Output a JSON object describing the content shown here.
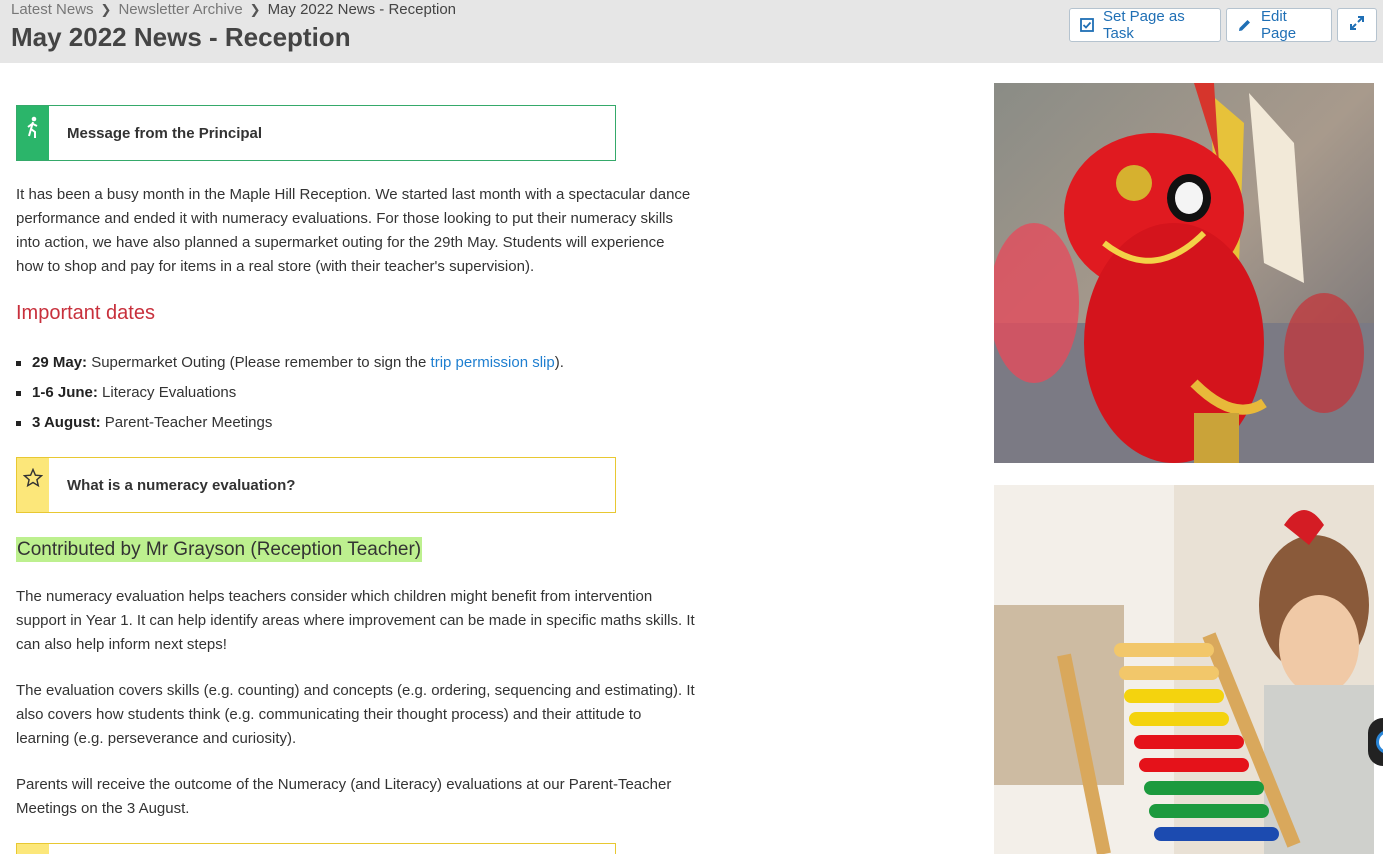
{
  "breadcrumb": {
    "items": [
      "Latest News",
      "Newsletter Archive"
    ],
    "current": "May 2022 News - Reception"
  },
  "page": {
    "title": "May 2022 News - Reception"
  },
  "actions": {
    "set_task": "Set Page as Task",
    "edit": "Edit Page",
    "expand_icon": "expand-icon"
  },
  "callouts": {
    "principal": {
      "title": "Message from the Principal",
      "icon": "walking-person-icon",
      "color": "#2bb56a"
    },
    "numeracy": {
      "title": "What is a numeracy evaluation?",
      "icon": "star-icon",
      "color": "#fce77a"
    }
  },
  "intro": "It has been a busy month in the Maple Hill Reception. We started last month with a spectacular dance performance and ended it with numeracy evaluations. For those looking to put their numeracy skills into action, we have also planned a supermarket outing for the 29th May. Students will experience how to shop and pay for items in a real store (with their teacher's supervision).",
  "important": {
    "heading": "Important dates",
    "items": [
      {
        "date": "29 May:",
        "text_before": " Supermarket Outing (Please remember to sign the ",
        "link": "trip permission slip",
        "text_after": ")."
      },
      {
        "date": "1-6 June:",
        "text": " Literacy Evaluations"
      },
      {
        "date": "3 August:",
        "text": " Parent-Teacher Meetings"
      }
    ]
  },
  "contributor": "Contributed by Mr Grayson (Reception Teacher)",
  "paragraphs": [
    "The numeracy evaluation helps teachers consider which children might benefit from intervention support in Year 1. It can help identify areas where improvement can be made in specific maths skills. It can also help inform next steps!",
    "The evaluation covers skills (e.g. counting) and concepts (e.g. ordering, sequencing and estimating). It also covers how students think (e.g. communicating their thought process) and their attitude to learning (e.g. perseverance and curiosity).",
    "Parents will receive the outcome of the Numeracy (and Literacy) evaluations at our Parent-Teacher Meetings on the 3 August."
  ],
  "colors": {
    "accent": "#1f6fb5",
    "heading_red": "#c8303c",
    "highlight": "#bdf08f"
  }
}
